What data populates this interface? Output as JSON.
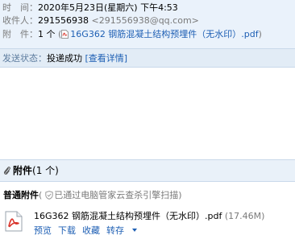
{
  "header": {
    "time_label": "时　间：",
    "time_value": "2020年5月23日(星期六) 下午4:53",
    "recipient_label": "收件人：",
    "recipient_name": "291556938",
    "recipient_email": "<291556938@qq.com>",
    "attachment_label": "附　件：",
    "attachment_count": "1 个",
    "attachment_paren_open": "(",
    "attachment_filename": "16G362 钢筋混凝土结构预埋件（无水印）.pdf",
    "attachment_paren_close": ")"
  },
  "status": {
    "label": "发送状态：",
    "value": "投递成功",
    "details_link": "[查看详情]"
  },
  "attachments": {
    "icon": "paperclip-icon",
    "title": "附件",
    "count": "(1 个)",
    "section_title": "普通附件",
    "scan_note": "已通过电脑管家云查杀引擎扫描",
    "scan_open": "(",
    "scan_close": ")",
    "file": {
      "icon": "pdf-file-icon",
      "name": "16G362 钢筋混凝土结构预埋件（无水印）.pdf",
      "size": "(17.46M)",
      "actions": {
        "preview": "预览",
        "download": "下载",
        "favorite": "收藏",
        "forward": "转存"
      }
    }
  },
  "colors": {
    "link": "#1e5fb4",
    "header_bg": "#eaf2fb",
    "status_bg": "#e2ecf6",
    "pdf_red": "#d9342b"
  }
}
